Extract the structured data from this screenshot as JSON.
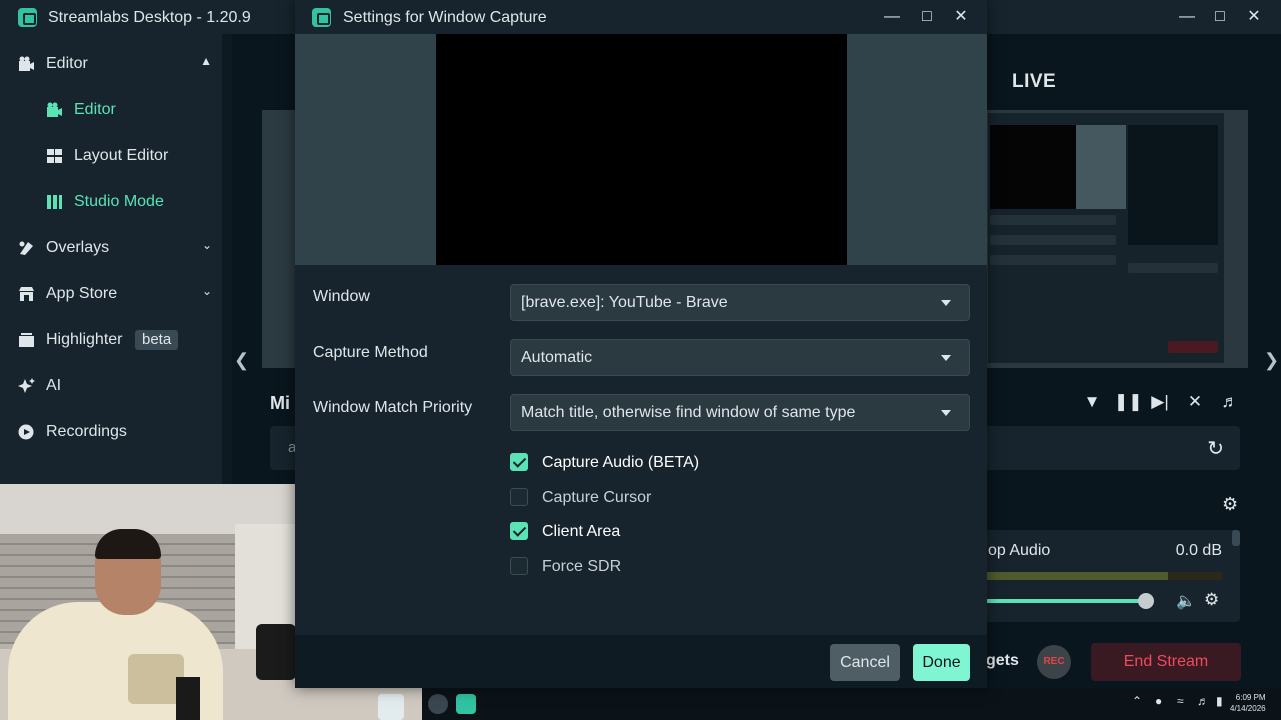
{
  "app": {
    "title": "Streamlabs Desktop - 1.20.9",
    "window_controls": [
      "minimize",
      "maximize",
      "close"
    ]
  },
  "sidebar": {
    "items": [
      {
        "label": "Editor",
        "icon": "editor-icon",
        "expanded": true
      },
      {
        "label": "Editor",
        "icon": "editor-icon",
        "active": true,
        "sub": true
      },
      {
        "label": "Layout Editor",
        "icon": "layout-icon",
        "sub": true
      },
      {
        "label": "Studio Mode",
        "icon": "studio-mode-icon",
        "active": true,
        "sub": true
      },
      {
        "label": "Overlays",
        "icon": "overlays-icon"
      },
      {
        "label": "App Store",
        "icon": "store-icon"
      },
      {
        "label": "Highlighter",
        "icon": "highlighter-icon",
        "badge": "beta"
      },
      {
        "label": "AI",
        "icon": "ai-icon"
      },
      {
        "label": "Recordings",
        "icon": "recordings-icon"
      }
    ]
  },
  "main": {
    "live_label": "LIVE",
    "mini_label": "Mi",
    "search_stub": "a",
    "mixer": {
      "source": "op Audio",
      "db": "0.0 dB",
      "level": 0.77
    },
    "widgets_label": "gets",
    "rec_label": "REC",
    "end_stream_label": "End Stream"
  },
  "dialog": {
    "title": "Settings for Window Capture",
    "fields": [
      {
        "label": "Window",
        "value": "[brave.exe]: YouTube - Brave"
      },
      {
        "label": "Capture Method",
        "value": "Automatic"
      },
      {
        "label": "Window Match Priority",
        "value": "Match title, otherwise find window of same type"
      }
    ],
    "checkboxes": [
      {
        "label": "Capture Audio (BETA)",
        "checked": true
      },
      {
        "label": "Capture Cursor",
        "checked": false
      },
      {
        "label": "Client Area",
        "checked": true
      },
      {
        "label": "Force SDR",
        "checked": false
      }
    ],
    "cancel_label": "Cancel",
    "done_label": "Done"
  },
  "taskbar": {
    "time": "6:09 PM",
    "date": "4/14/2026"
  },
  "colors": {
    "accent": "#5be3b6",
    "done_button": "#80f5d2",
    "end_stream_text": "#ef4a5d",
    "background": "#09161d",
    "panel": "#17242d"
  }
}
